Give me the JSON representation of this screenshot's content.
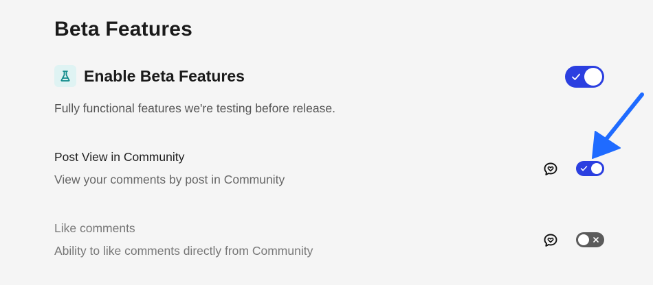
{
  "page": {
    "title": "Beta Features"
  },
  "beta": {
    "title": "Enable Beta Features",
    "description": "Fully functional features we're testing before release.",
    "enabled": true,
    "icon": "flask-icon"
  },
  "features": [
    {
      "title": "Post View in Community",
      "description": "View your comments by post in Community",
      "enabled": true,
      "icon": "comment-heart-icon"
    },
    {
      "title": "Like comments",
      "description": "Ability to like comments directly from Community",
      "enabled": false,
      "icon": "comment-heart-icon"
    }
  ],
  "colors": {
    "accent": "#2b3fe0",
    "toggle_off": "#5b5b5b",
    "arrow": "#1f6bff",
    "flask_bg": "#dff3f3",
    "flask": "#0f8a8a"
  }
}
